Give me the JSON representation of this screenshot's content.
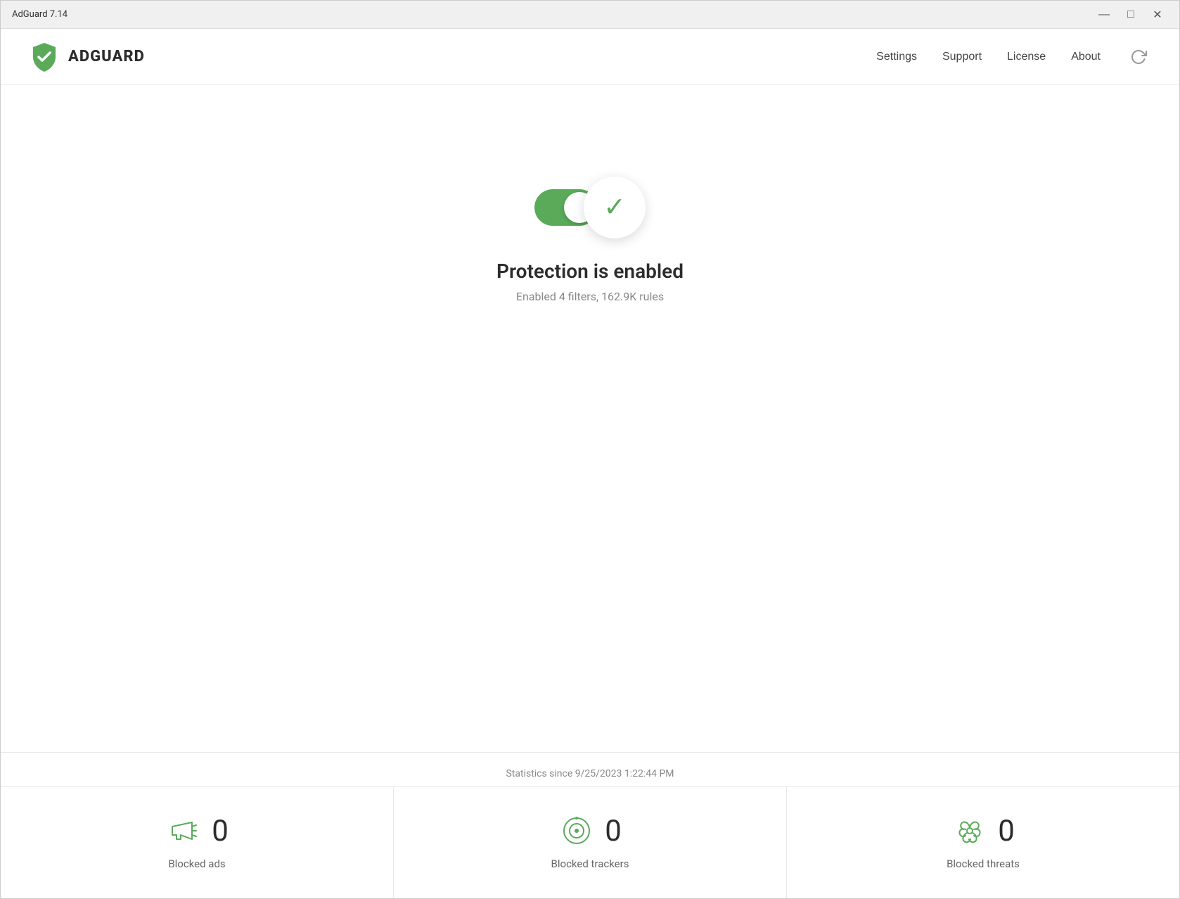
{
  "window": {
    "title": "AdGuard 7.14",
    "controls": {
      "minimize": "—",
      "maximize": "□",
      "close": "✕"
    }
  },
  "header": {
    "logo_text": "ADGUARD",
    "nav": {
      "settings": "Settings",
      "support": "Support",
      "license": "License",
      "about": "About"
    }
  },
  "protection": {
    "status": "Protection is enabled",
    "subtitle": "Enabled 4 filters, 162.9K rules"
  },
  "stats": {
    "since_label": "Statistics since 9/25/2023 1:22:44 PM",
    "items": [
      {
        "label": "Blocked ads",
        "count": "0"
      },
      {
        "label": "Blocked trackers",
        "count": "0"
      },
      {
        "label": "Blocked threats",
        "count": "0"
      }
    ]
  }
}
